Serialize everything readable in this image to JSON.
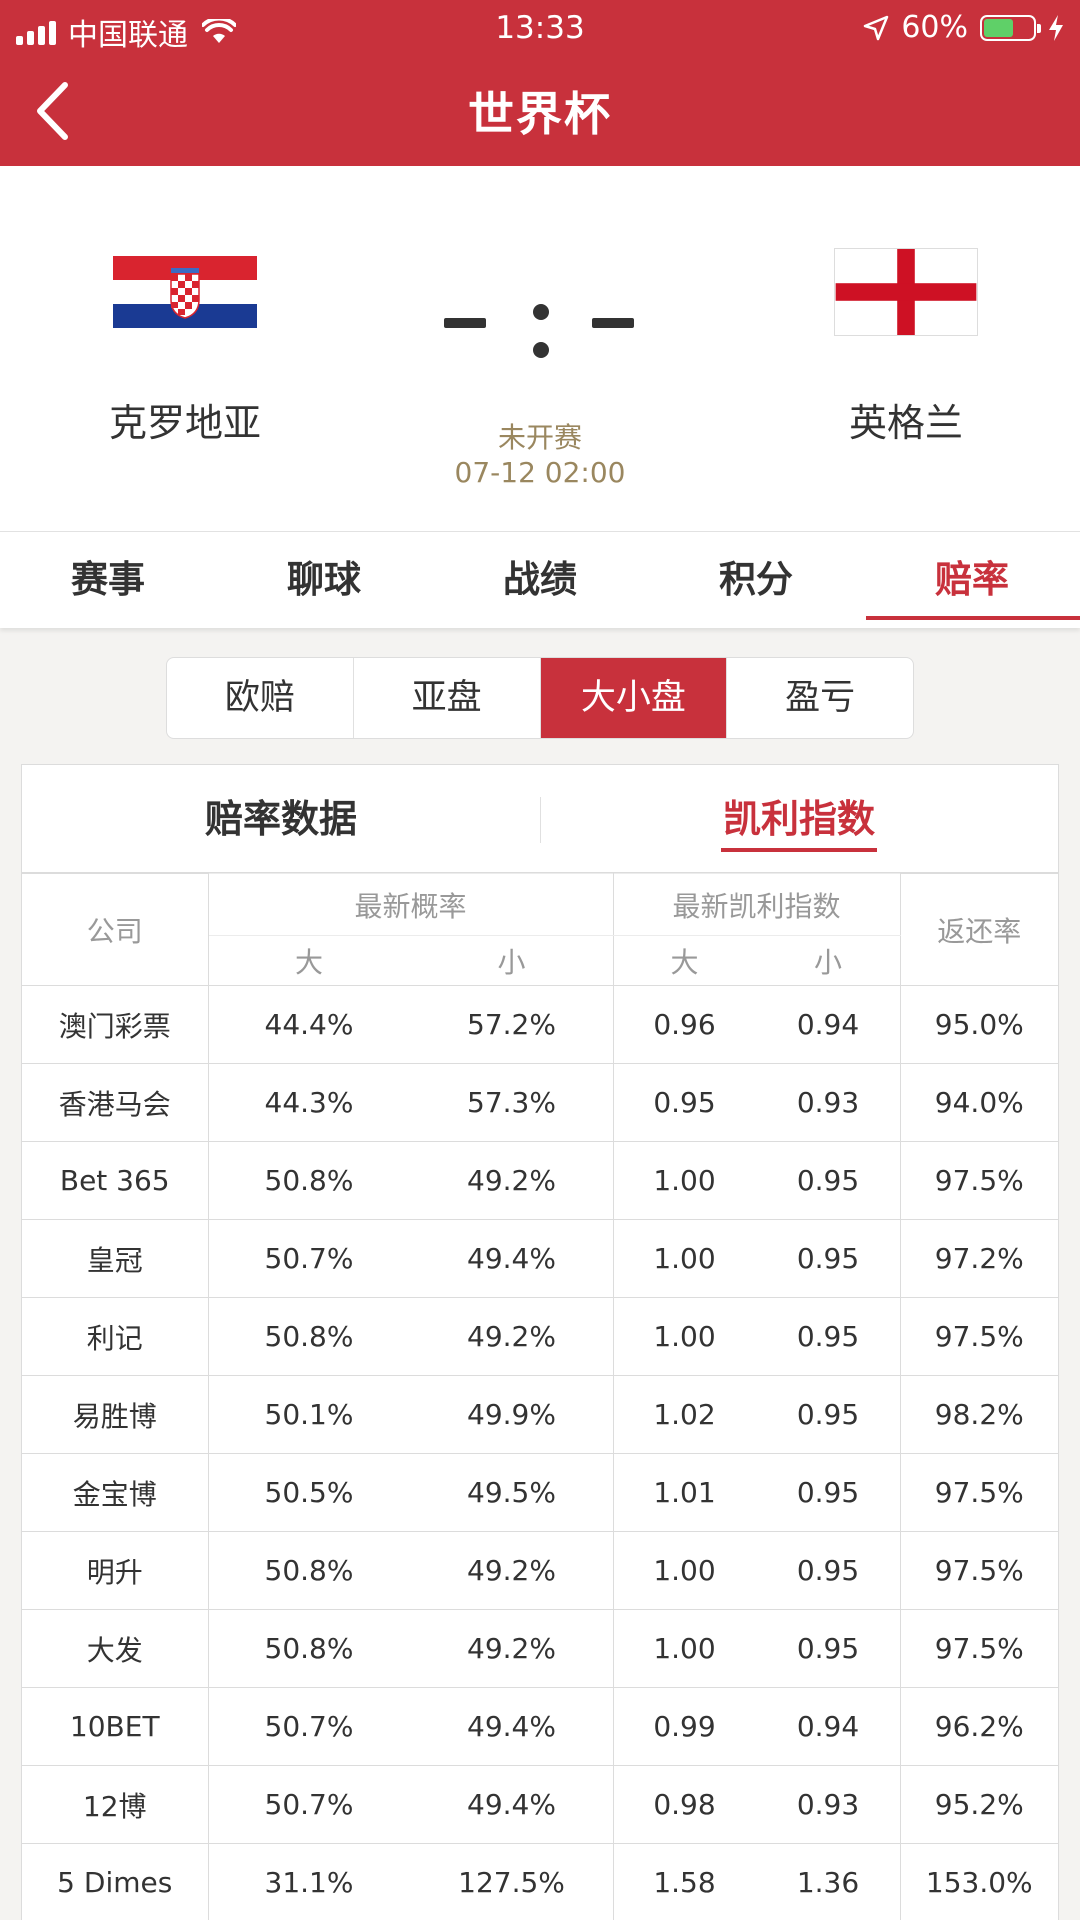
{
  "status_bar": {
    "carrier": "中国联通",
    "time": "13:33",
    "battery": "60%",
    "battery_level": 0.6
  },
  "header": {
    "title": "世界杯",
    "back_icon": "chevron-left-icon"
  },
  "match": {
    "home_team": "克罗地亚",
    "away_team": "英格兰",
    "home_score": "-",
    "away_score": "-",
    "status": "未开赛",
    "kickoff": "07-12 02:00"
  },
  "main_tabs": [
    "赛事",
    "聊球",
    "战绩",
    "积分",
    "赔率"
  ],
  "main_tab_active": "赔率",
  "segments": [
    "欧赔",
    "亚盘",
    "大小盘",
    "盈亏"
  ],
  "segment_active": "大小盘",
  "sub_tabs": {
    "left": "赔率数据",
    "right": "凯利指数"
  },
  "table": {
    "headers": {
      "company": "公司",
      "prob_group": "最新概率",
      "kelly_group": "最新凯利指数",
      "return_rate": "返还率",
      "big": "大",
      "small": "小"
    },
    "rows": [
      {
        "company": "澳门彩票",
        "prob_big": "44.4%",
        "prob_small": "57.2%",
        "kelly_big": "0.96",
        "kelly_small": "0.94",
        "return": "95.0%"
      },
      {
        "company": "香港马会",
        "prob_big": "44.3%",
        "prob_small": "57.3%",
        "kelly_big": "0.95",
        "kelly_small": "0.93",
        "return": "94.0%"
      },
      {
        "company": "Bet 365",
        "prob_big": "50.8%",
        "prob_small": "49.2%",
        "kelly_big": "1.00",
        "kelly_small": "0.95",
        "return": "97.5%"
      },
      {
        "company": "皇冠",
        "prob_big": "50.7%",
        "prob_small": "49.4%",
        "kelly_big": "1.00",
        "kelly_small": "0.95",
        "return": "97.2%"
      },
      {
        "company": "利记",
        "prob_big": "50.8%",
        "prob_small": "49.2%",
        "kelly_big": "1.00",
        "kelly_small": "0.95",
        "return": "97.5%"
      },
      {
        "company": "易胜博",
        "prob_big": "50.1%",
        "prob_small": "49.9%",
        "kelly_big": "1.02",
        "kelly_small": "0.95",
        "return": "98.2%"
      },
      {
        "company": "金宝博",
        "prob_big": "50.5%",
        "prob_small": "49.5%",
        "kelly_big": "1.01",
        "kelly_small": "0.95",
        "return": "97.5%"
      },
      {
        "company": "明升",
        "prob_big": "50.8%",
        "prob_small": "49.2%",
        "kelly_big": "1.00",
        "kelly_small": "0.95",
        "return": "97.5%"
      },
      {
        "company": "大发",
        "prob_big": "50.8%",
        "prob_small": "49.2%",
        "kelly_big": "1.00",
        "kelly_small": "0.95",
        "return": "97.5%"
      },
      {
        "company": "10BET",
        "prob_big": "50.7%",
        "prob_small": "49.4%",
        "kelly_big": "0.99",
        "kelly_small": "0.94",
        "return": "96.2%"
      },
      {
        "company": "12博",
        "prob_big": "50.7%",
        "prob_small": "49.4%",
        "kelly_big": "0.98",
        "kelly_small": "0.93",
        "return": "95.2%"
      },
      {
        "company": "5 Dimes",
        "prob_big": "31.1%",
        "prob_small": "127.5%",
        "kelly_big": "1.58",
        "kelly_small": "1.36",
        "return": "153.0%"
      }
    ]
  },
  "colors": {
    "brand_red": "#c8313c",
    "status_gold": "#9a875f",
    "battery_green": "#5fd068"
  }
}
